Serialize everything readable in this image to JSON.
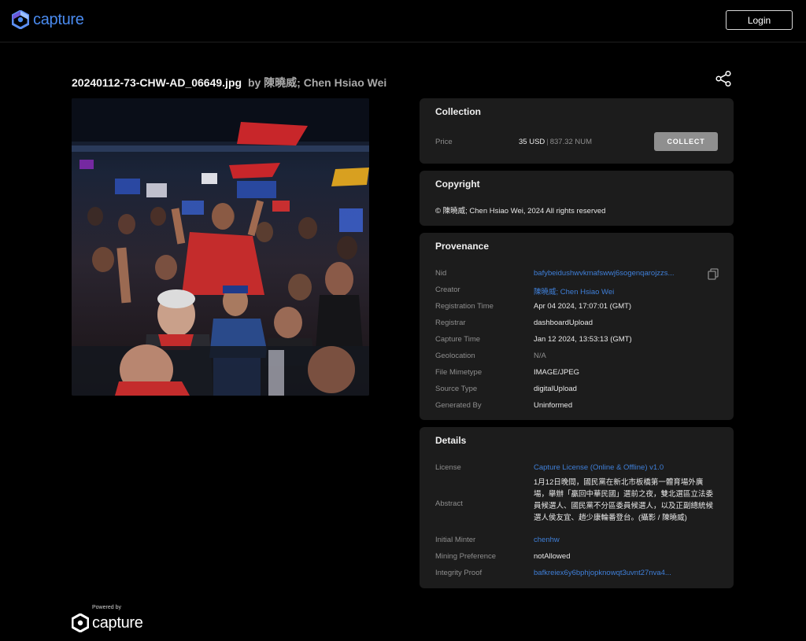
{
  "header": {
    "brand": "capture",
    "login_label": "Login"
  },
  "asset": {
    "filename": "20240112-73-CHW-AD_06649.jpg",
    "byline": "by 陳曉威; Chen Hsiao Wei"
  },
  "collection": {
    "title": "Collection",
    "price_label": "Price",
    "price_usd": "35 USD",
    "price_num": "837.32 NUM",
    "collect_label": "COLLECT"
  },
  "copyright": {
    "title": "Copyright",
    "text": "© 陳曉威; Chen Hsiao Wei, 2024 All rights reserved"
  },
  "provenance": {
    "title": "Provenance",
    "rows": [
      {
        "label": "Nid",
        "value": "bafybeidushwvkmafswwj6sogenqarojzzs..."
      },
      {
        "label": "Creator",
        "value": "陳曉威; Chen Hsiao Wei"
      },
      {
        "label": "Registration Time",
        "value": "Apr 04 2024, 17:07:01 (GMT)"
      },
      {
        "label": "Registrar",
        "value": "dashboardUpload"
      },
      {
        "label": "Capture Time",
        "value": "Jan 12 2024, 13:53:13 (GMT)"
      },
      {
        "label": "Geolocation",
        "value": "N/A"
      },
      {
        "label": "File Mimetype",
        "value": "IMAGE/JPEG"
      },
      {
        "label": "Source Type",
        "value": "digitalUpload"
      },
      {
        "label": "Generated By",
        "value": "Uninformed"
      }
    ]
  },
  "details": {
    "title": "Details",
    "license_label": "License",
    "license_value": "Capture License (Online & Offline) v1.0",
    "abstract_label": "Abstract",
    "abstract_value": "1月12日晚間，國民黨在新北市板橋第一體育場外廣場，舉辦「贏回中華民國」選前之夜，雙北選區立法委員候選人、國民黨不分區委員候選人，以及正副總統候選人侯友宜、趙少康輪番登台。(攝影 / 陳曉威)",
    "minter_label": "Initial Minter",
    "minter_value": "chenhw",
    "mining_label": "Mining Preference",
    "mining_value": "notAllowed",
    "proof_label": "Integrity Proof",
    "proof_value": "bafkreiex6y6bphjopknowqt3uvnt27nva4..."
  },
  "footer": {
    "powered_by": "Powered by",
    "brand": "capture"
  },
  "colors": {
    "background": "#000000",
    "panel": "#1c1c1c",
    "link": "#3f7fd8",
    "brand_blue": "#4a8bf0",
    "collect_button": "#8f8f8f"
  },
  "icons": [
    "capture-logo-icon",
    "share-icon",
    "copy-icon"
  ]
}
